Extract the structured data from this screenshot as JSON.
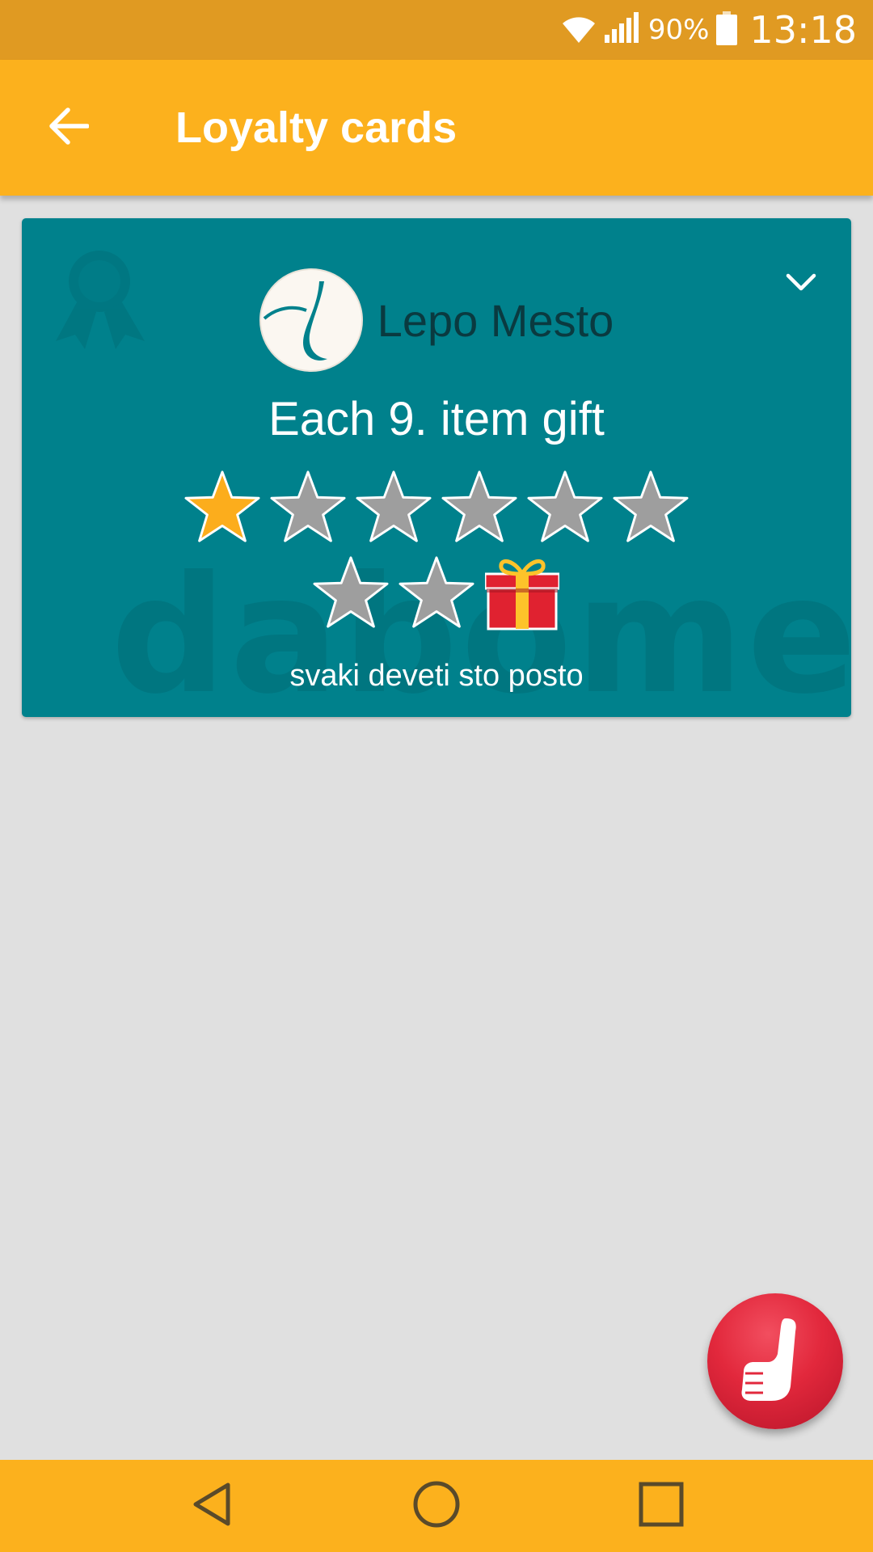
{
  "status_bar": {
    "battery_percent": "90%",
    "time": "13:18",
    "icons": [
      "wifi-icon",
      "signal-icon",
      "battery-icon"
    ]
  },
  "app_bar": {
    "title": "Loyalty cards",
    "back_icon": "arrow-back-icon"
  },
  "card": {
    "merchant_name": "Lepo Mesto",
    "offer_title": "Each 9. item gift",
    "description": "svaki deveti sto posto",
    "stamps_collected": 1,
    "stamps_total": 8,
    "reward_icon": "gift-icon",
    "colors": {
      "card_background": "#00818c",
      "star_filled": "#fcad1c",
      "star_empty": "#9e9e9e"
    }
  },
  "fab": {
    "icon": "dabome-hand-icon"
  },
  "navigation": {
    "icons": [
      "back-triangle-icon",
      "home-circle-icon",
      "recents-square-icon"
    ]
  },
  "theme": {
    "primary": "#fcb11d",
    "status_bar": "#e09a22",
    "background": "#e0e0e0"
  }
}
